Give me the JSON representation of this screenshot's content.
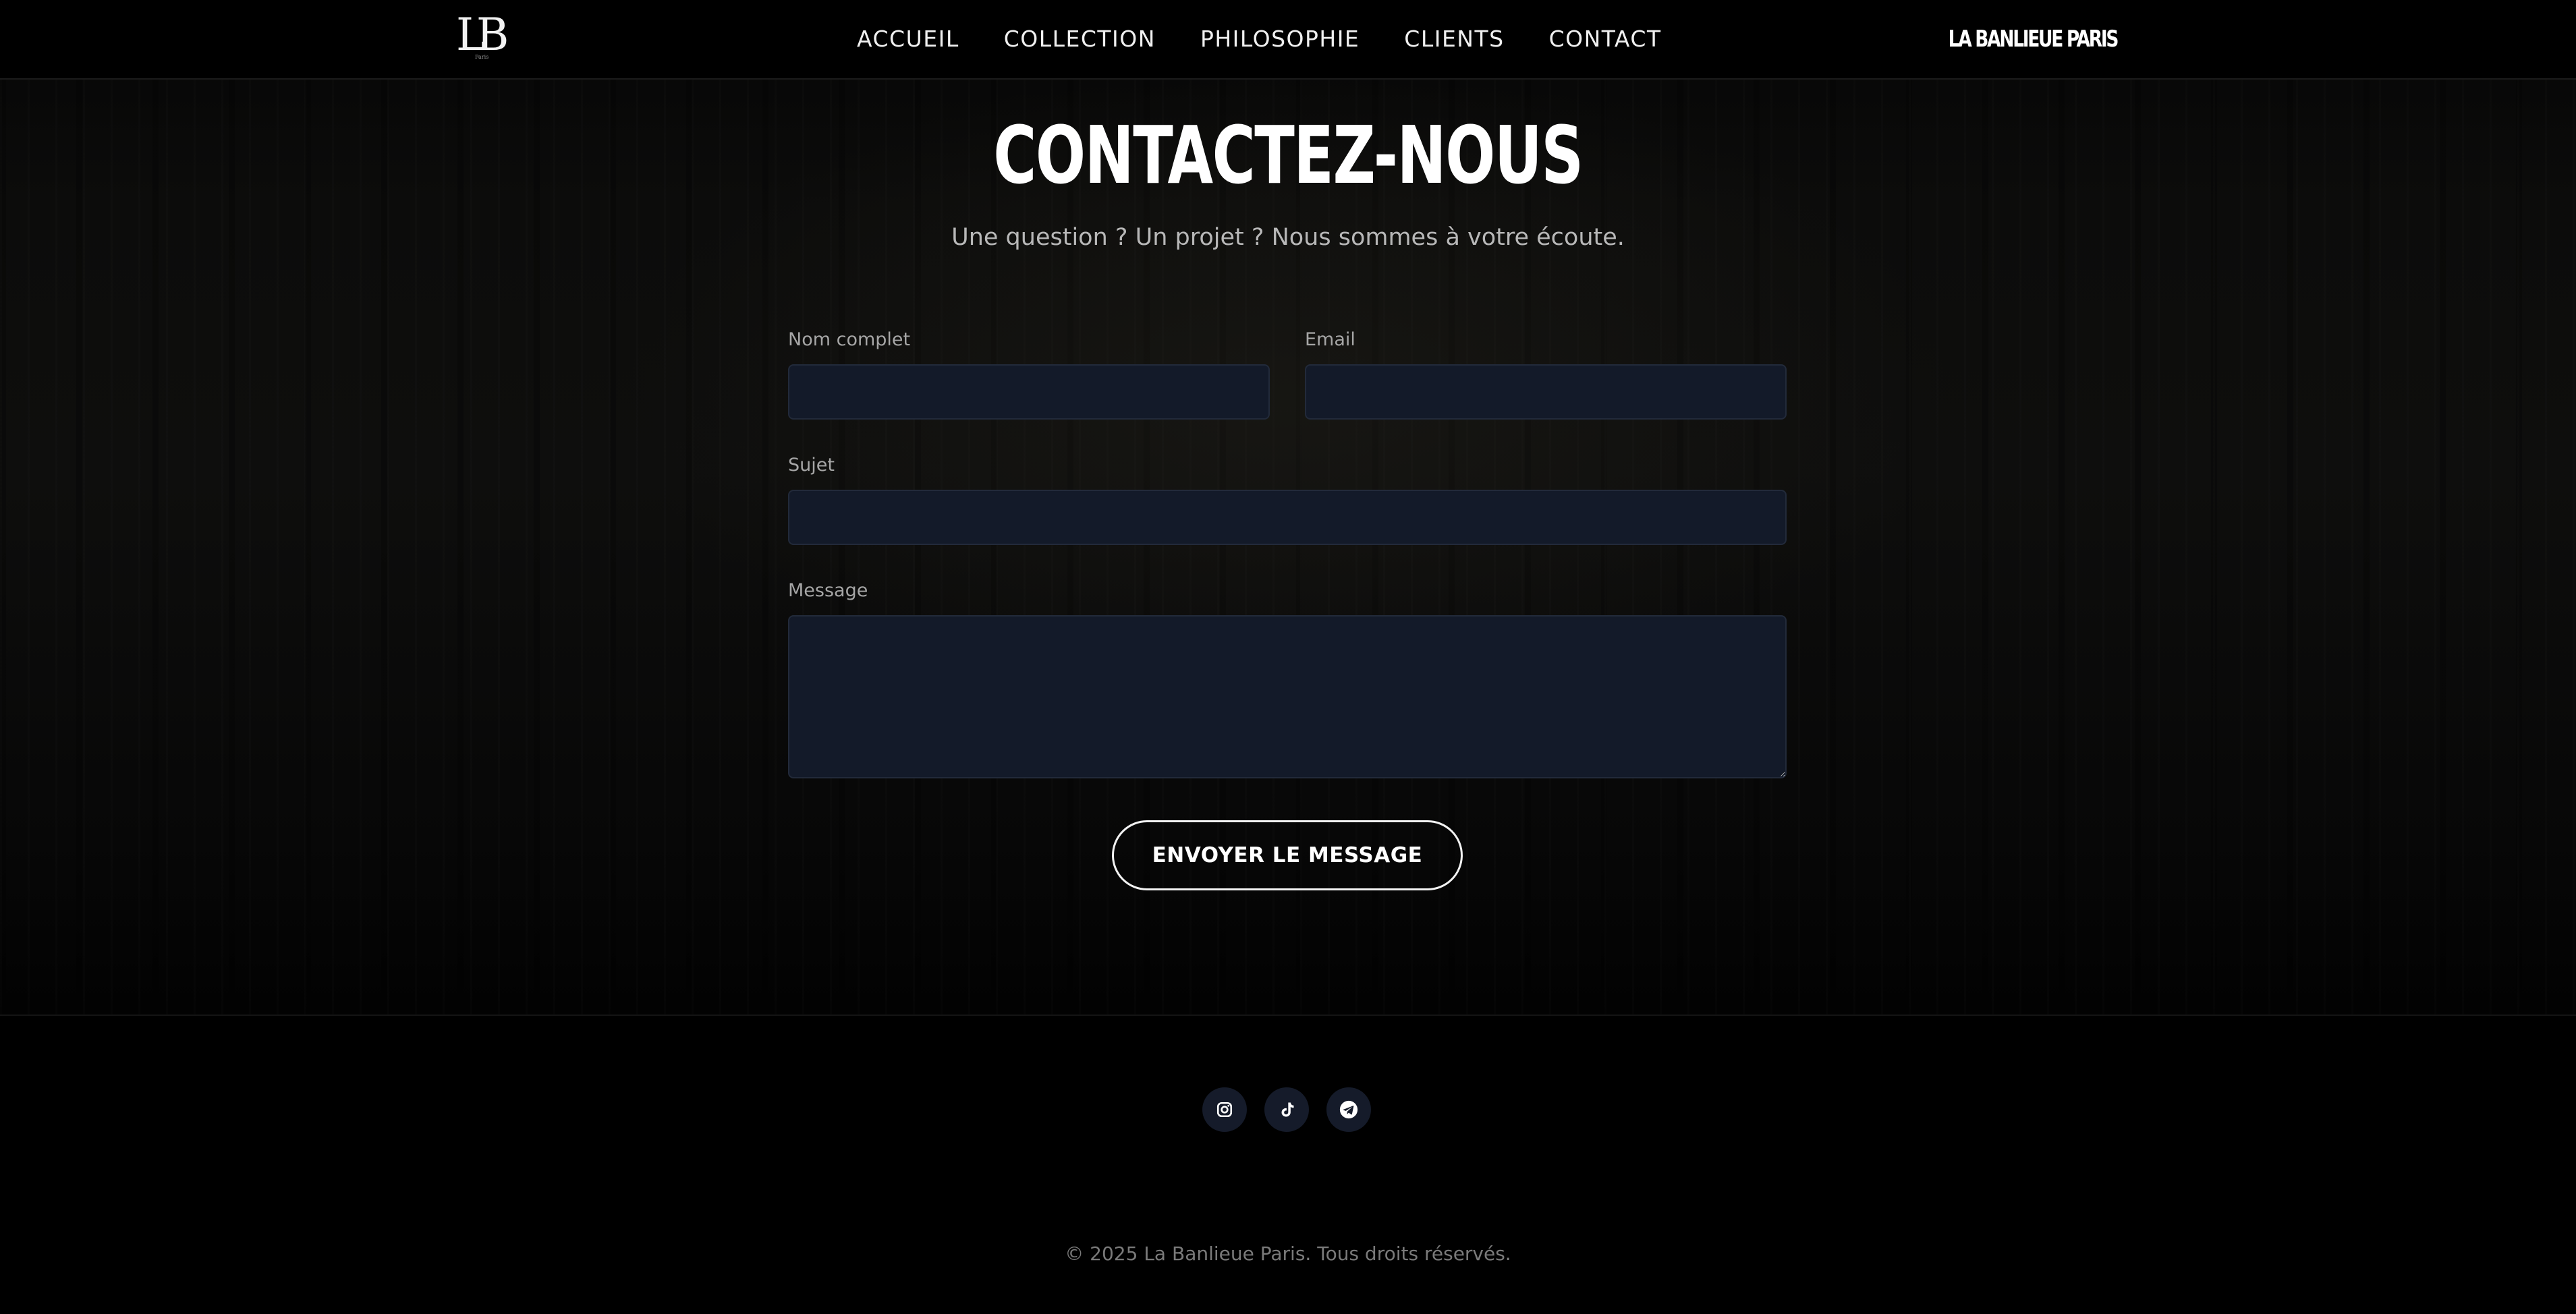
{
  "header": {
    "logo_text": "LB",
    "logo_subtext": "Paris",
    "nav": [
      {
        "label": "ACCUEIL"
      },
      {
        "label": "COLLECTION"
      },
      {
        "label": "PHILOSOPHIE"
      },
      {
        "label": "CLIENTS"
      },
      {
        "label": "CONTACT"
      }
    ],
    "brand": "LA BANLIEUE PARIS"
  },
  "hero": {
    "title": "CONTACTEZ-NOUS",
    "subtitle": "Une question ? Un projet ? Nous sommes à votre écoute."
  },
  "form": {
    "name_label": "Nom complet",
    "name_value": "",
    "email_label": "Email",
    "email_value": "",
    "subject_label": "Sujet",
    "subject_value": "",
    "message_label": "Message",
    "message_value": "",
    "submit_label": "ENVOYER LE MESSAGE"
  },
  "footer": {
    "social": [
      {
        "icon": "instagram-icon"
      },
      {
        "icon": "tiktok-icon"
      },
      {
        "icon": "telegram-icon"
      }
    ],
    "copyright": "© 2025 La Banlieue Paris. Tous droits réservés."
  },
  "colors": {
    "background": "#000000",
    "field_bg": "#131a29",
    "social_bg": "#151b2a",
    "text": "#ffffff",
    "muted_text": "#a6a6a6"
  }
}
